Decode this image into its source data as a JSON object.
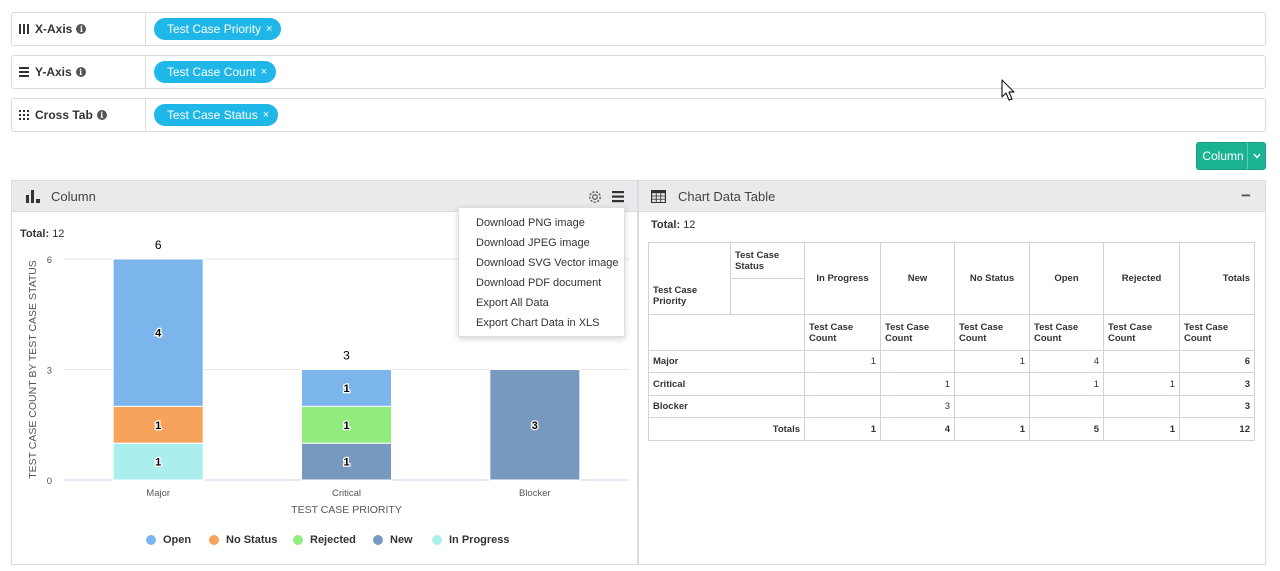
{
  "axes": {
    "x_axis": {
      "label": "X-Axis",
      "chip": "Test Case Priority"
    },
    "y_axis": {
      "label": "Y-Axis",
      "chip": "Test Case Count"
    },
    "cross_tab": {
      "label": "Cross Tab",
      "chip": "Test Case Status"
    },
    "info_glyph": "i",
    "remove_glyph": "×"
  },
  "chart_type_button": {
    "label": "Column"
  },
  "chart_panel": {
    "title": "Column",
    "total_label": "Total:",
    "total_value": "12"
  },
  "export_menu": [
    "Download PNG image",
    "Download JPEG image",
    "Download SVG Vector image",
    "Download PDF document",
    "Export All Data",
    "Export Chart Data in XLS"
  ],
  "table_panel": {
    "title": "Chart Data Table",
    "total_label": "Total:",
    "total_value": "12",
    "collapse_glyph": "−"
  },
  "data_table": {
    "corner_status": "Test Case Status",
    "corner_priority": "Test Case Priority",
    "columns": [
      "In Progress",
      "New",
      "No Status",
      "Open",
      "Rejected",
      "Totals"
    ],
    "measure": "Test Case Count",
    "rows": [
      {
        "label": "Major",
        "values": [
          "1",
          "",
          "1",
          "4",
          "",
          "6"
        ]
      },
      {
        "label": "Critical",
        "values": [
          "",
          "1",
          "",
          "1",
          "1",
          "3"
        ]
      },
      {
        "label": "Blocker",
        "values": [
          "",
          "3",
          "",
          "",
          "",
          "3"
        ]
      }
    ],
    "totals": {
      "label": "Totals",
      "values": [
        "1",
        "4",
        "1",
        "5",
        "1",
        "12"
      ]
    }
  },
  "colors": {
    "Open": "#7cb5ec",
    "No Status": "#f7a35c",
    "Rejected": "#90ed7d",
    "New": "#7798bf",
    "In Progress": "#aaeeee"
  },
  "chart_data": {
    "type": "bar",
    "stacked": true,
    "categories": [
      "Major",
      "Critical",
      "Blocker"
    ],
    "xlabel": "TEST CASE PRIORITY",
    "ylabel": "TEST CASE COUNT BY TEST CASE STATUS",
    "ylim": [
      0,
      6
    ],
    "yticks": [
      0,
      3,
      6
    ],
    "stack_totals": [
      6,
      3,
      3
    ],
    "stack_total_labels": [
      "6",
      "3",
      ""
    ],
    "legend_position": "bottom",
    "series": [
      {
        "name": "In Progress",
        "values": [
          1,
          0,
          0
        ]
      },
      {
        "name": "New",
        "values": [
          0,
          1,
          3
        ]
      },
      {
        "name": "Rejected",
        "values": [
          0,
          1,
          0
        ]
      },
      {
        "name": "No Status",
        "values": [
          1,
          0,
          0
        ]
      },
      {
        "name": "Open",
        "values": [
          4,
          1,
          0
        ]
      }
    ],
    "legend": [
      "Open",
      "No Status",
      "Rejected",
      "New",
      "In Progress"
    ]
  }
}
